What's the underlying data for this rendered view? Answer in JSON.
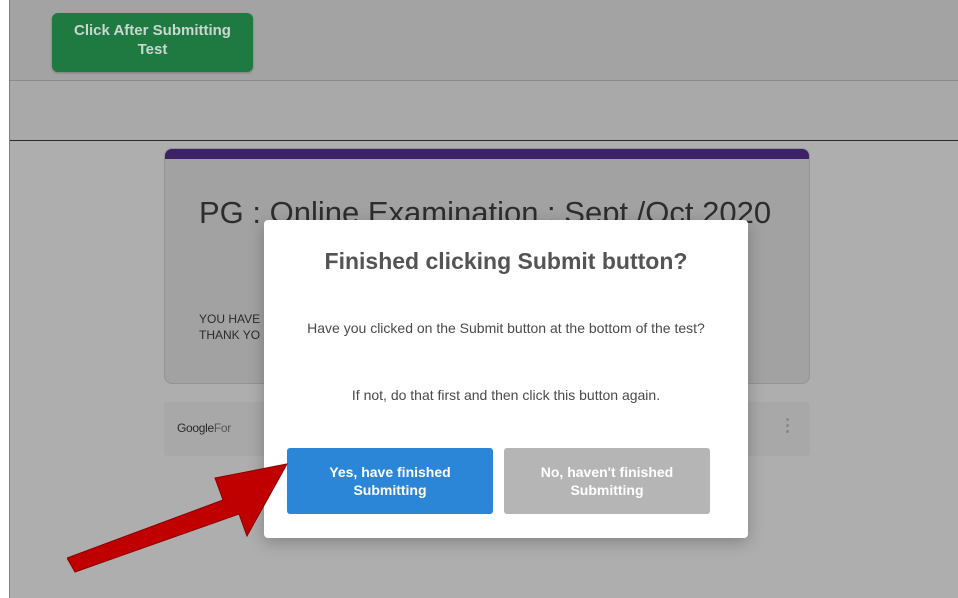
{
  "top_bar": {
    "submit_button_label": "Click After Submitting Test"
  },
  "form": {
    "title": "PG : Online Examination : Sept /Oct 2020",
    "message_line1": "YOU HAVE",
    "message_line2": "THANK YO",
    "footer_logo_google": "Google",
    "footer_logo_forms": "For"
  },
  "dialog": {
    "title": "Finished clicking Submit button?",
    "text1": "Have you clicked on the Submit button at the bottom of the test?",
    "text2": "If not, do that first and then click this button again.",
    "yes_button_label": "Yes, have finished Submitting",
    "no_button_label": "No, haven't finished Submitting"
  },
  "colors": {
    "top_button_green": "#1f7a41",
    "form_accent_purple": "#3d2268",
    "yes_button_blue": "#2c86d8",
    "no_button_gray": "#b5b5b5",
    "arrow_red": "#c00000"
  },
  "icons": {
    "menu": "kebab-icon",
    "pointer": "red-arrow-icon"
  }
}
